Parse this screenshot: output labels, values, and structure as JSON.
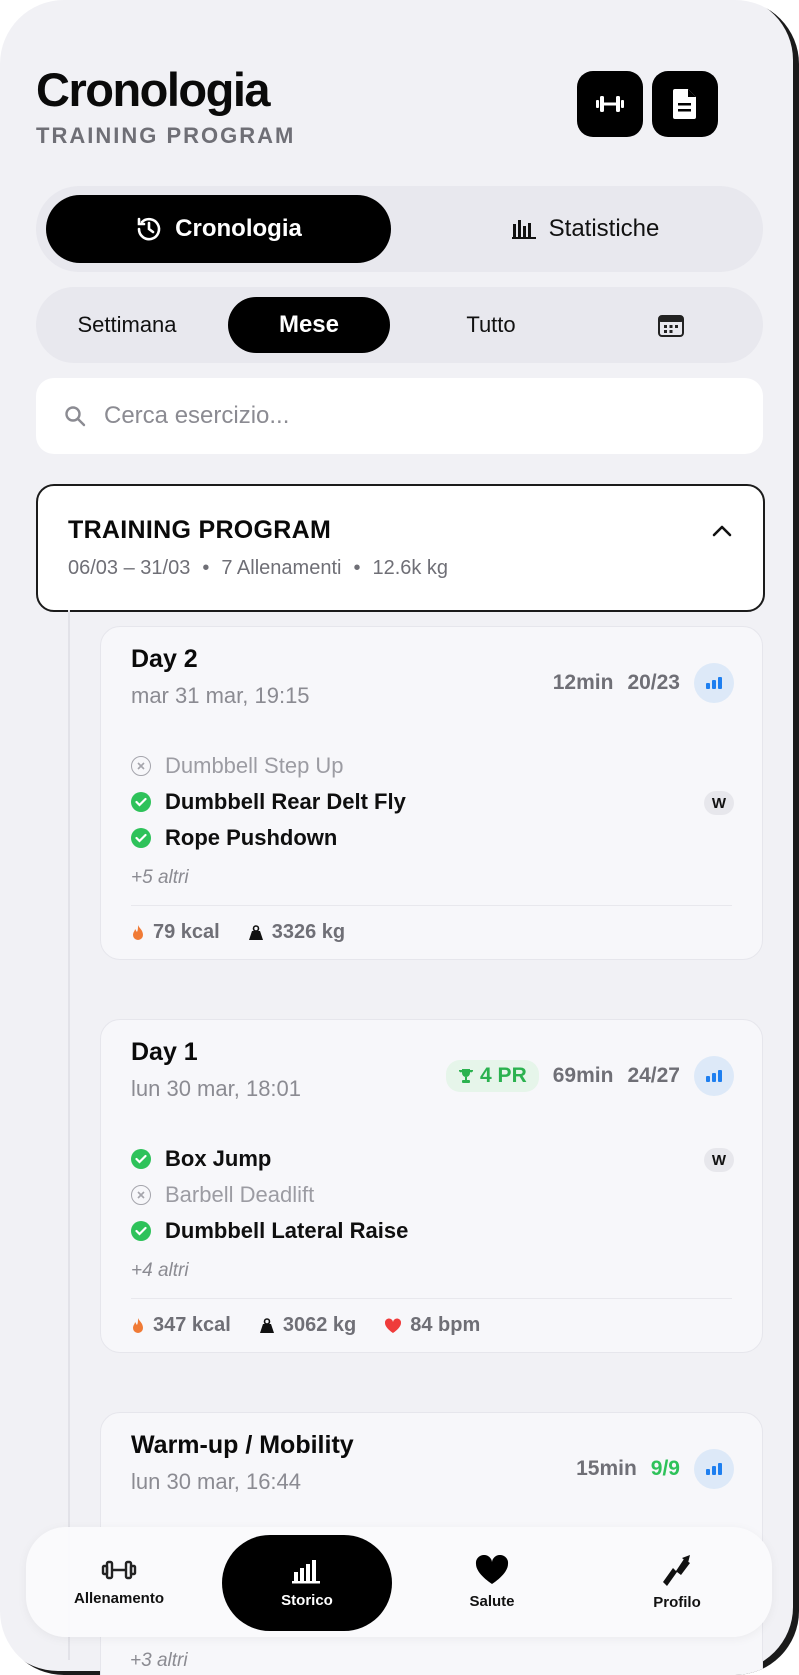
{
  "header": {
    "title": "Cronologia",
    "subtitle": "TRAINING PROGRAM"
  },
  "view_toggle": {
    "active": "Cronologia",
    "other": "Statistiche"
  },
  "period": [
    "Settimana",
    "Mese",
    "Tutto"
  ],
  "period_selected": "Mese",
  "search": {
    "placeholder": "Cerca esercizio..."
  },
  "program": {
    "title": "TRAINING PROGRAM",
    "range": "06/03 – 31/03",
    "workouts": "7 Allenamenti",
    "volume": "12.6k kg"
  },
  "workouts": [
    {
      "title": "Day 2",
      "date": "mar 31 mar, 19:15",
      "duration": "12min",
      "sets": "20/23",
      "exercises": [
        {
          "name": "Dumbbell Step Up",
          "status": "skipped"
        },
        {
          "name": "Dumbbell Rear Delt Fly",
          "status": "done",
          "badge": "W"
        },
        {
          "name": "Rope Pushdown",
          "status": "done"
        }
      ],
      "more": "+5 altri",
      "kcal": "79 kcal",
      "weight": "3326 kg"
    },
    {
      "title": "Day 1",
      "date": "lun 30 mar, 18:01",
      "pr": "4 PR",
      "duration": "69min",
      "sets": "24/27",
      "exercises": [
        {
          "name": "Box Jump",
          "status": "done",
          "badge": "W"
        },
        {
          "name": "Barbell Deadlift",
          "status": "skipped"
        },
        {
          "name": "Dumbbell Lateral Raise",
          "status": "done"
        }
      ],
      "more": "+4 altri",
      "kcal": "347 kcal",
      "weight": "3062 kg",
      "bpm": "84 bpm"
    },
    {
      "title": "Warm-up / Mobility",
      "date": "lun 30 mar, 16:44",
      "duration": "15min",
      "sets": "9/9",
      "more": "+3 altri"
    }
  ],
  "tabbar": [
    "Allenamento",
    "Storico",
    "Salute",
    "Profilo"
  ],
  "tabbar_active": "Storico",
  "colors": {
    "accent": "#000000",
    "success": "#2ec25a",
    "pr": "#2bb24f",
    "flame": "#f07a35",
    "heart": "#ef3b3b",
    "signal": "#1e7ff0"
  }
}
